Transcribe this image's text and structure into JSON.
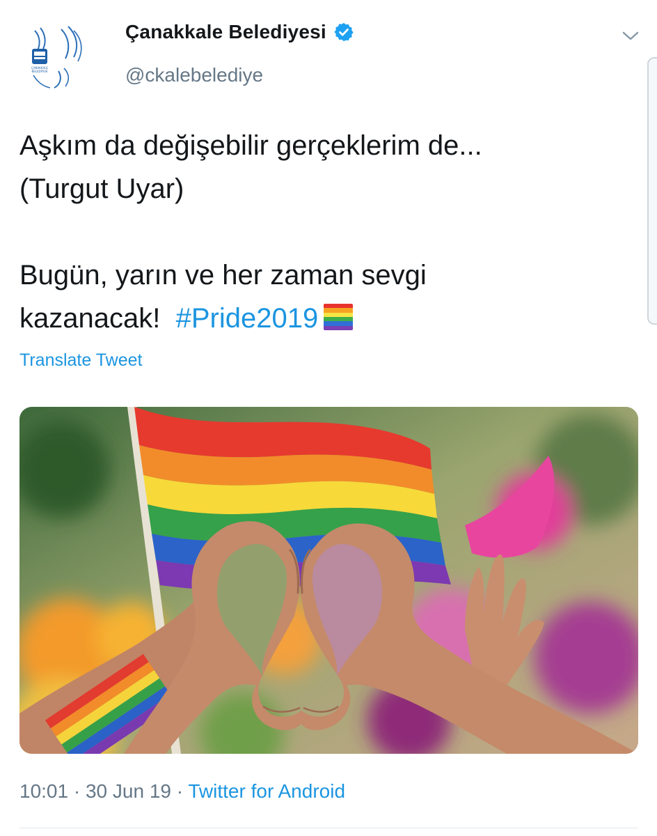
{
  "account": {
    "display_name": "Çanakkale Belediyesi",
    "handle": "@ckalebelediye",
    "verified": true,
    "avatar_logo_text": "ÇANAKKALE BELEDİYESİ"
  },
  "icons": {
    "verified": "verified-badge-icon",
    "menu": "chevron-down-icon",
    "emoji": "rainbow-flag-emoji"
  },
  "tweet": {
    "line1": "Aşkım da değişebilir gerçeklerim de...",
    "line2": "(Turgut Uyar)",
    "line3": "Bugün, yarın ve her zaman sevgi",
    "line4": "kazanacak!",
    "hashtag": "#Pride2019"
  },
  "translate_label": "Translate Tweet",
  "meta": {
    "time": "10:01",
    "sep1": " · ",
    "date": "30 Jun 19",
    "sep2": " · ",
    "source": "Twitter for Android"
  },
  "colors": {
    "link": "#1b95e0",
    "muted": "#657786",
    "text": "#14171a",
    "verified": "#1da1f2"
  }
}
